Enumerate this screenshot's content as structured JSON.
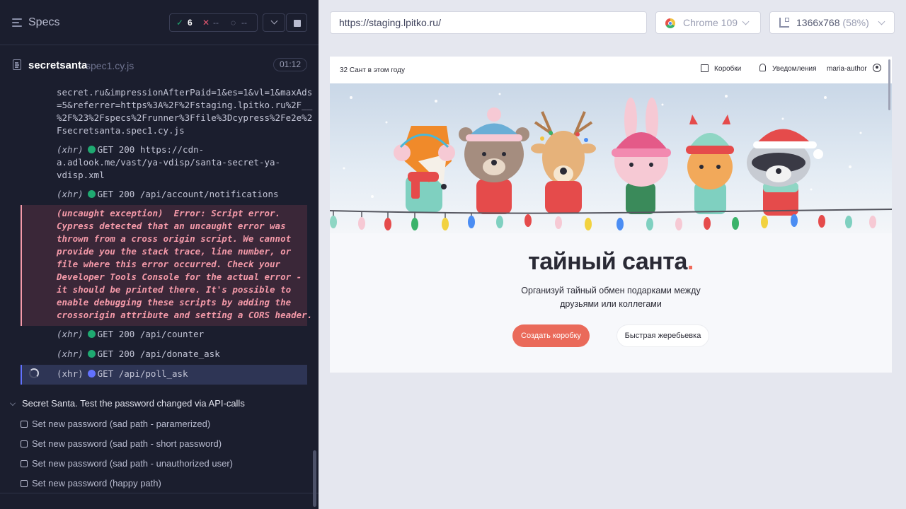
{
  "specs_bar": {
    "title": "Specs",
    "passed": "6",
    "failed": "--",
    "pending": "--"
  },
  "spec": {
    "name": "secretsanta",
    "file": "spec1.cy.js",
    "duration": "01:12"
  },
  "log": {
    "url_lines": [
      "secret.ru&impressionAfterPaid=1&es=1&vl=1&maxAds",
      "=5&referrer=https%3A%2F%2Fstaging.lpitko.ru%2F__",
      "%2F%23%2Fspecs%2Frunner%3Ffile%3Dcypress%2Fe2e%2",
      "Fsecretsanta.spec1.cy.js"
    ],
    "entries": [
      {
        "kind": "(xhr)",
        "text": "GET 200 https://cdn-",
        "cont": [
          "a.adlook.me/vast/ya-vdisp/santa-secret-ya-",
          "vdisp.xml"
        ]
      },
      {
        "kind": "(xhr)",
        "text": "GET 200 /api/account/notifications"
      }
    ],
    "error_lines": [
      "(uncaught exception)  Error: Script error.",
      "Cypress detected that an uncaught error was",
      "thrown from a cross origin script. We cannot",
      "provide you the stack trace, line number, or",
      "file where this error occurred. Check your",
      "Developer Tools Console for the actual error -",
      "it should be printed there. It's possible to",
      "enable debugging these scripts by adding the",
      "crossorigin attribute and setting a CORS header."
    ],
    "after": [
      {
        "kind": "(xhr)",
        "text": "GET 200 /api/counter"
      },
      {
        "kind": "(xhr)",
        "text": "GET 200 /api/donate_ask"
      }
    ],
    "pending": {
      "kind": "(xhr)",
      "text": "GET /api/poll_ask"
    }
  },
  "suite": {
    "title": "Secret Santa. Test the password changed via API-calls",
    "tests": [
      "Set new password (sad path - paramerized)",
      "Set new password (sad path - short password)",
      "Set new password (sad path - unauthorized user)",
      "Set new password (happy path)"
    ]
  },
  "browser_bar": {
    "url": "https://staging.lpitko.ru/",
    "browser": "Chrome 109",
    "viewport": "1366x768",
    "scale": "(58%)"
  },
  "app": {
    "counter": "32 Сант в этом году",
    "nav_boxes": "Коробки",
    "nav_notifications": "Уведомления",
    "nav_user": "maria-author",
    "headline": "тайный санта",
    "headline_dot": ".",
    "subtitle_line1": "Организуй тайный обмен подарками между",
    "subtitle_line2": "друзьями или коллегами",
    "btn_create": "Создать коробку",
    "btn_draw": "Быстрая жеребьевка"
  },
  "colors": {
    "passed": "#1fa971",
    "failed": "#e45770",
    "error_text": "#f59aa9",
    "accent_blue": "#6272ff",
    "brand_coral": "#ea6a5a"
  }
}
